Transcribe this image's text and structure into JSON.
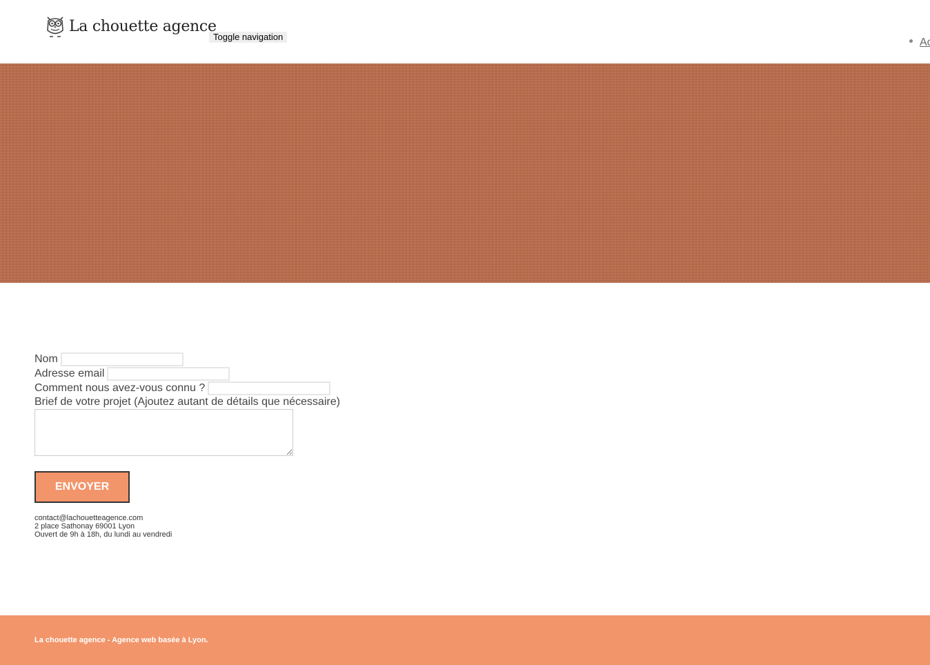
{
  "header": {
    "logo_text": "La chouette agence",
    "toggle_label": "Toggle navigation",
    "nav_items": [
      {
        "label": "Ac"
      }
    ]
  },
  "form": {
    "name_label": "Nom",
    "email_label": "Adresse email",
    "source_label": "Comment nous avez-vous connu ?",
    "brief_label": "Brief de votre projet (Ajoutez autant de détails que nécessaire)",
    "submit_label": "ENVOYER"
  },
  "contact": {
    "email": "contact@lachouetteagence.com",
    "address": "2 place Sathonay 69001 Lyon",
    "hours": "Ouvert de 9h à 18h, du lundi au vendredi"
  },
  "footer": {
    "text": "La chouette agence - Agence web basée à Lyon."
  },
  "colors": {
    "hero": "#b86d4c",
    "accent": "#f2956b"
  }
}
